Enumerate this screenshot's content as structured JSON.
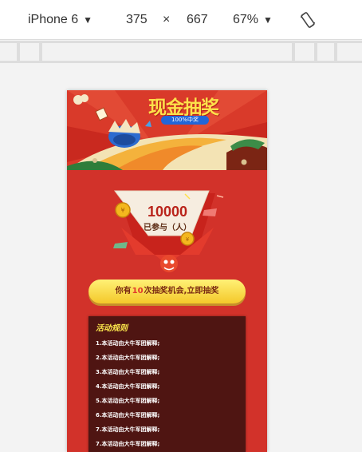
{
  "toolbar": {
    "device_label": "iPhone 6",
    "width_value": "375",
    "times_symbol": "×",
    "height_value": "667",
    "zoom_label": "67%",
    "rotate_icon": "rotate-icon"
  },
  "page": {
    "banner": {
      "title": "现金抽奖",
      "badge": "100%中奖"
    },
    "participation": {
      "count": "10000",
      "label": "已参与（人）"
    },
    "cta": {
      "prefix": "你有",
      "chances": "10",
      "suffix": "次抽奖机会,立即抽奖"
    },
    "rules": {
      "title": "活动规则",
      "items": [
        "1.本活动由大牛军团解释;",
        "2.本活动由大牛军团解释;",
        "3.本活动由大牛军团解释;",
        "4.本活动由大牛军团解释;",
        "5.本活动由大牛军团解释;",
        "6.本活动由大牛军团解释;",
        "7.本活动由大牛军团解释;",
        "7.本活动由大牛军团解释;"
      ]
    }
  },
  "colors": {
    "page_background": "#d2322a",
    "title_yellow": "#fde04a",
    "badge_blue": "#2266d8",
    "rules_panel": "#4f1512",
    "count_red": "#b9231a"
  }
}
